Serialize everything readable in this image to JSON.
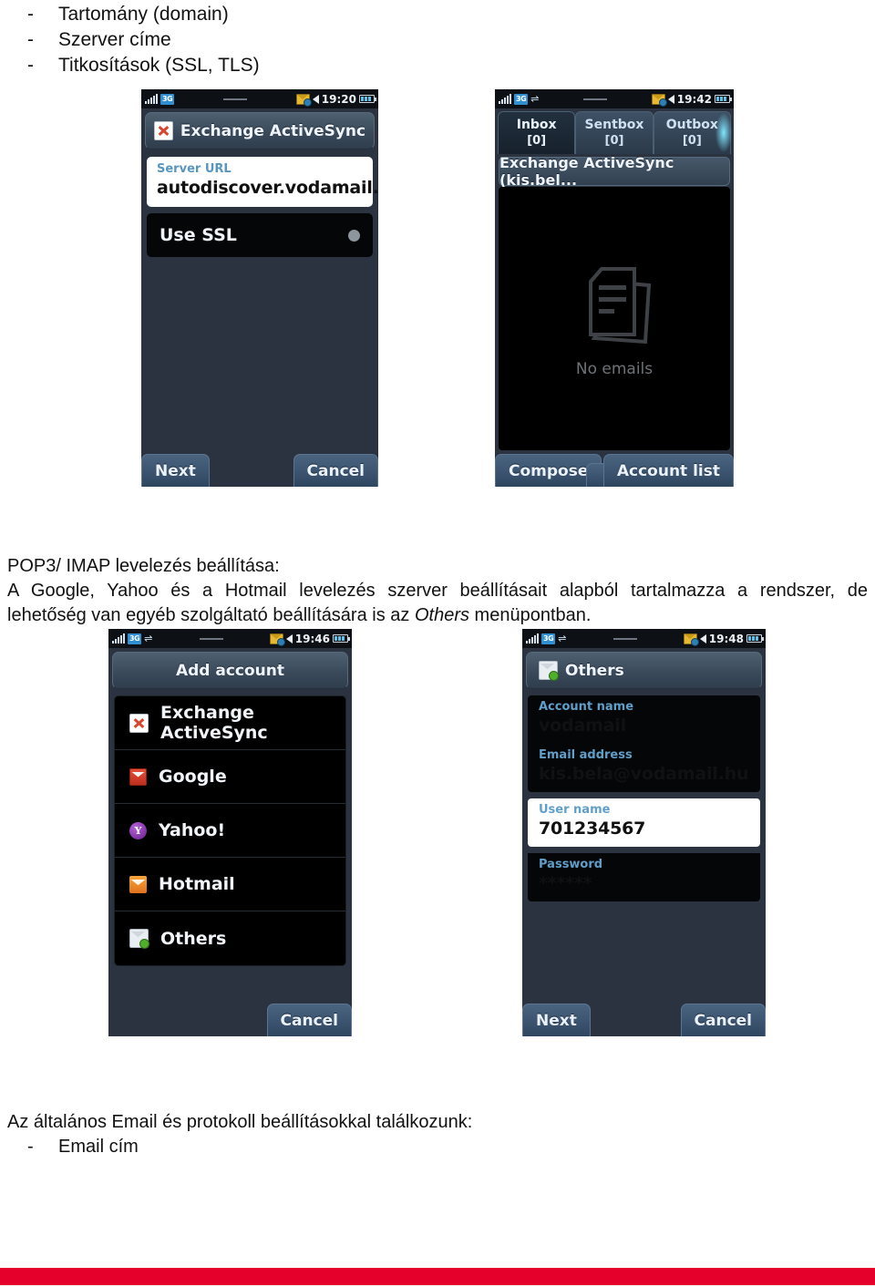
{
  "document": {
    "top_list": [
      {
        "dash": "-",
        "text": "Tartomány (domain)"
      },
      {
        "dash": "-",
        "text": "Szerver címe"
      },
      {
        "dash": "-",
        "text": "Titkosítások (SSL, TLS)"
      }
    ],
    "paragraph_pop3": {
      "line1": "POP3/ IMAP levelezés beállítása:",
      "line2": "A Google, Yahoo és a Hotmail levelezés szerver beállításait alapból tartalmazza a rendszer, de",
      "line3_a": "lehetőség van egyéb szolgáltató beállítására is az ",
      "line3_italic": "Others",
      "line3_b": " menüpontban."
    },
    "paragraph_bottom": {
      "line1": "Az általános Email és protokoll beállításokkal találkozunk:",
      "sub_dash": "-",
      "sub_text": "Email cím"
    },
    "accent_red": "#e4002b"
  },
  "phone1": {
    "status": {
      "network": "3G",
      "time": "19:20"
    },
    "title": "Exchange ActiveSync",
    "fields": [
      {
        "label": "Server URL",
        "value": "autodiscover.vodamail.hu"
      }
    ],
    "toggle_row": {
      "label": "Use SSL"
    },
    "softkeys": {
      "left": "Next",
      "right": "Cancel"
    }
  },
  "phone2": {
    "status": {
      "network": "3G",
      "time": "19:42"
    },
    "tabs": [
      {
        "label": "Inbox",
        "count": "[0]"
      },
      {
        "label": "Sentbox",
        "count": "[0]"
      },
      {
        "label": "Outbox",
        "count": "[0]"
      }
    ],
    "account_bar": "Exchange ActiveSync (kis.bel...",
    "empty_text": "No emails",
    "softkeys": {
      "left": "Compose",
      "right": "Account list"
    }
  },
  "phone3": {
    "status": {
      "network": "3G",
      "time": "19:46"
    },
    "title": "Add account",
    "items": [
      {
        "label": "Exchange ActiveSync",
        "icon": "exchange-activesync-icon"
      },
      {
        "label": "Google",
        "icon": "google-icon"
      },
      {
        "label": "Yahoo!",
        "icon": "yahoo-icon"
      },
      {
        "label": "Hotmail",
        "icon": "hotmail-icon"
      },
      {
        "label": "Others",
        "icon": "others-icon"
      }
    ],
    "softkeys": {
      "right": "Cancel"
    }
  },
  "phone4": {
    "status": {
      "network": "3G",
      "time": "19:48"
    },
    "title": "Others",
    "fields": [
      {
        "label": "Account name",
        "value": "vodamail",
        "focused": false
      },
      {
        "label": "Email address",
        "value": "kis.bela@vodamail.hu",
        "focused": false
      },
      {
        "label": "User name",
        "value": "701234567",
        "focused": true
      },
      {
        "label": "Password",
        "value": "******",
        "focused": false
      }
    ],
    "softkeys": {
      "left": "Next",
      "right": "Cancel"
    }
  }
}
